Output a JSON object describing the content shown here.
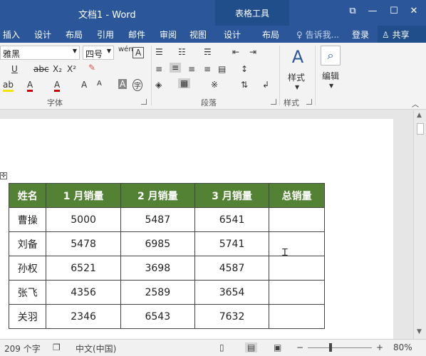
{
  "titlebar": {
    "title": "文档1 - Word",
    "context_group": "表格工具",
    "restore_symbol": "⧉",
    "minimize_symbol": "—",
    "maximize_symbol": "☐",
    "close_symbol": "✕"
  },
  "tabs": {
    "insert": "插入",
    "design": "设计",
    "layout": "布局",
    "references": "引用",
    "mailings": "邮件",
    "review": "审阅",
    "view": "视图",
    "table_design": "设计",
    "table_layout": "布局",
    "tell_me": "告诉我...",
    "signin": "登录",
    "share": "共享"
  },
  "ribbon": {
    "font_name": "雅黑",
    "font_size": "四号",
    "styles_label": "样式",
    "editing_label": "编辑",
    "groups": {
      "font": "字体",
      "paragraph": "段落",
      "styles": "样式"
    },
    "font_buttons": {
      "wen": "wén",
      "A_box": "A",
      "underline": "U",
      "strike": "abc",
      "subscript": "X₂",
      "superscript": "X²",
      "grow": "A",
      "shrink": "A",
      "char_shade": "A",
      "phonetic": "字",
      "highlight": "ab",
      "fontcolor": "A"
    }
  },
  "table": {
    "headers": [
      "姓名",
      "1 月销量",
      "2 月销量",
      "3 月销量",
      "总销量"
    ],
    "rows": [
      [
        "曹操",
        "5000",
        "5487",
        "6541",
        ""
      ],
      [
        "刘备",
        "5478",
        "6985",
        "5741",
        ""
      ],
      [
        "孙权",
        "6521",
        "3698",
        "4587",
        ""
      ],
      [
        "张飞",
        "4356",
        "2589",
        "3654",
        ""
      ],
      [
        "关羽",
        "2346",
        "6543",
        "7632",
        ""
      ]
    ],
    "header_color": "#548235"
  },
  "statusbar": {
    "word_count": "209 个字",
    "language": "中文(中国)",
    "zoom": "80%",
    "zoom_out": "−",
    "zoom_in": "+"
  },
  "colors": {
    "accent": "#2b579a",
    "context_tab": "#1f4e8a"
  }
}
